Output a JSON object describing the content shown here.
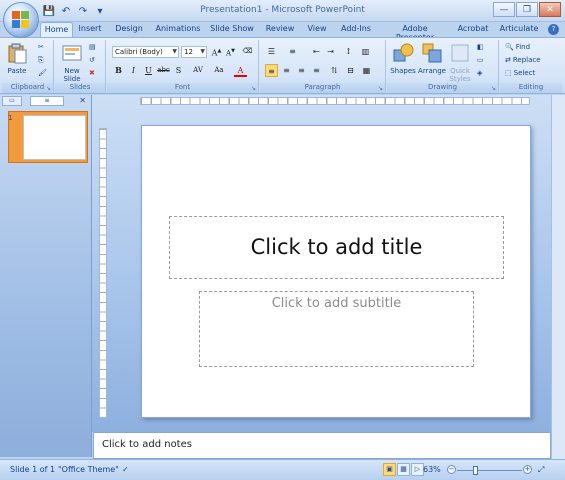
{
  "window": {
    "title": "Presentation1 - Microsoft PowerPoint",
    "minimize": "—",
    "restore": "❐",
    "close": "✕"
  },
  "qat": {
    "save_icon": "💾",
    "undo_icon": "↶",
    "repeat_icon": "↷",
    "customize_icon": "▾"
  },
  "tabs": [
    "Home",
    "Insert",
    "Design",
    "Animations",
    "Slide Show",
    "Review",
    "View",
    "Add-Ins",
    "Adobe Presenter",
    "Acrobat",
    "Articulate"
  ],
  "help": "?",
  "ribbon": {
    "clipboard": {
      "label": "Clipboard",
      "paste": "Paste"
    },
    "slides": {
      "label": "Slides",
      "new_slide": "New Slide"
    },
    "font": {
      "label": "Font",
      "font_name": "Calibri (Body)",
      "font_size": "12"
    },
    "paragraph": {
      "label": "Paragraph"
    },
    "drawing": {
      "label": "Drawing",
      "shapes": "Shapes",
      "arrange": "Arrange",
      "quick_styles": "Quick Styles"
    },
    "editing": {
      "label": "Editing",
      "find": "Find",
      "replace": "Replace",
      "select": "Select"
    }
  },
  "slide_panel": {
    "thumb_number": "1"
  },
  "slide": {
    "title_placeholder": "Click to add title",
    "subtitle_placeholder": "Click to add subtitle"
  },
  "notes": {
    "placeholder": "Click to add notes"
  },
  "status": {
    "slide_info": "Slide 1 of 1",
    "theme": "\"Office Theme\"",
    "zoom": "63%",
    "zoom_level": 0.63
  },
  "colors": {
    "accent": "#f39b3c",
    "ribbon": "#d6e5f8",
    "text": "#15428b"
  }
}
